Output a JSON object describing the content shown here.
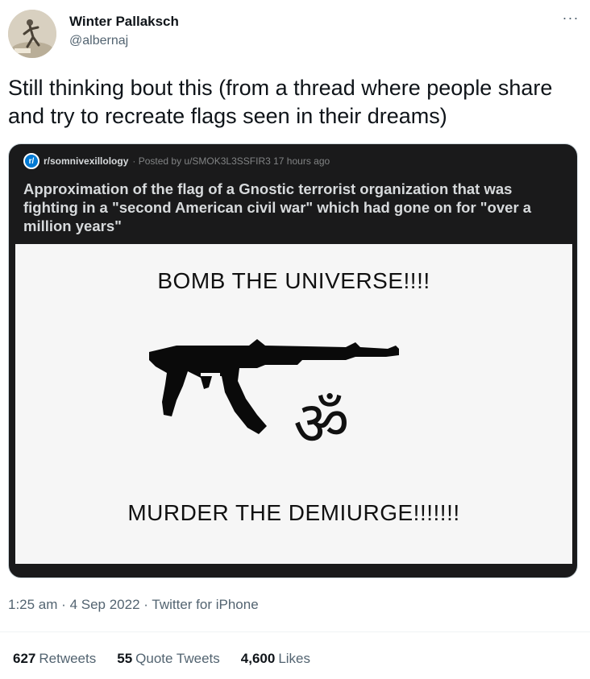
{
  "author": {
    "name": "Winter Pallaksch",
    "handle": "@albernaj",
    "avatar_icon": "vintage-figure-avatar"
  },
  "more_icon": "···",
  "tweet": {
    "text": "Still thinking bout this (from a thread where people share and try to recreate flags seen in their dreams)"
  },
  "embedded_post": {
    "subreddit_icon": "r/",
    "subreddit": "r/somnivexillology",
    "posted_by": "· Posted by u/SMOK3L3SSFIR3 17 hours ago",
    "title": "Approximation of the flag of a Gnostic terrorist organization that was fighting in a \"second American civil war\" which had gone on for \"over a million years\"",
    "flag": {
      "top_text": "BOMB THE UNIVERSE!!!!",
      "bottom_text": "MURDER THE DEMIURGE!!!!!!!",
      "om_symbol": "ॐ",
      "gun_icon": "rifle-silhouette-icon"
    }
  },
  "meta": {
    "time": "1:25 am",
    "date": "4 Sep 2022",
    "source": "Twitter for iPhone",
    "separator": "·"
  },
  "stats": {
    "retweets_count": "627",
    "retweets_label": "Retweets",
    "quotes_count": "55",
    "quotes_label": "Quote Tweets",
    "likes_count": "4,600",
    "likes_label": "Likes"
  },
  "colors": {
    "text_primary": "#0f1419",
    "text_secondary": "#536471",
    "reddit_dark": "#1a1a1b",
    "reddit_blue": "#0079d3"
  }
}
